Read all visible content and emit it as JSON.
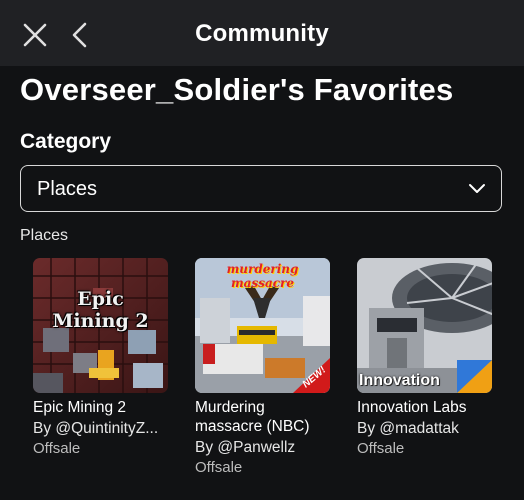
{
  "header": {
    "title": "Community",
    "close_icon": "close-icon",
    "back_icon": "chevron-left-icon"
  },
  "page": {
    "title": "Overseer_Soldier's Favorites"
  },
  "category": {
    "label": "Category",
    "selected": "Places",
    "chevron_icon": "chevron-down-icon"
  },
  "section": {
    "label": "Places"
  },
  "items": [
    {
      "name": "Epic Mining 2",
      "creator": "By @QuintinityZ...",
      "status": "Offsale",
      "thumb_text": "Epic Mining 2"
    },
    {
      "name": "Murdering massacre (NBC)",
      "creator": "By @Panwellz",
      "status": "Offsale",
      "thumb_text": "murdering massacre",
      "thumb_badge": "NEW!"
    },
    {
      "name": "Innovation Labs",
      "creator": "By @madattak",
      "status": "Offsale",
      "thumb_text": "Innovation"
    }
  ],
  "colors": {
    "background": "#111214",
    "topbar": "#202124",
    "text": "#ffffff",
    "secondary_text": "#bdbdbd",
    "border": "#d8d8d8"
  }
}
